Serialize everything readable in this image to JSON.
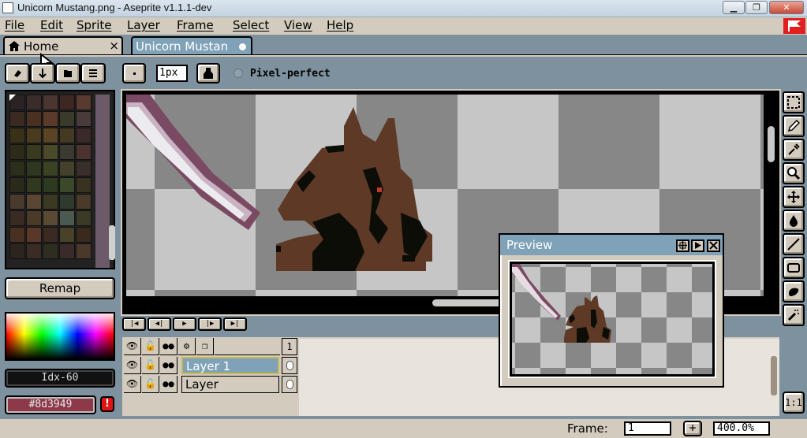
{
  "window": {
    "title": "Unicorn Mustang.png - Aseprite v1.1.1-dev",
    "minimize": "▁",
    "maximize": "❐",
    "close": "✕"
  },
  "menu": [
    "File",
    "Edit",
    "Sprite",
    "Layer",
    "Frame",
    "Select",
    "View",
    "Help"
  ],
  "tabs": {
    "home_label": "Home",
    "home_close": "×",
    "document_label": "Unicorn Mustan"
  },
  "context_bar": {
    "brush_size": "1px",
    "pixel_perfect_label": "Pixel-perfect",
    "pixel_perfect_checked": false
  },
  "palette": {
    "colors": [
      "#2a2224",
      "#3a2c2a",
      "#4a3530",
      "#3c2820",
      "#5a3a30",
      "#3a2a22",
      "#4a3020",
      "#5a3a28",
      "#3a3a2a",
      "#4a3a3a",
      "#3a3018",
      "#4a3a20",
      "#5a4424",
      "#443a22",
      "#3a2a2a",
      "#2e2a1a",
      "#3a3a20",
      "#4a4a2a",
      "#3a3a30",
      "#4a3430",
      "#2a2e1a",
      "#2e3820",
      "#3a4224",
      "#44402a",
      "#3a2e2a",
      "#2a2a1a",
      "#30381e",
      "#2c3a20",
      "#3a4a28",
      "#3a3220",
      "#4a3a2e",
      "#5a4632",
      "#3a3a22",
      "#2e3a2c",
      "#4a3a2a",
      "#3a2a24",
      "#4a3a28",
      "#5a4a34",
      "#4a5a50",
      "#3a3a26",
      "#4a3020",
      "#5a3828",
      "#3a2a22",
      "#4a4228",
      "#3a2a1e",
      "#2e241e",
      "#3a2c22",
      "#2e2e20",
      "#3a2a2a",
      "#4a382a"
    ],
    "remap_label": "Remap"
  },
  "colors": {
    "foreground_label": "Idx-60",
    "background_label": "#8d3949",
    "background_hex": "#8d3949",
    "warning_label": "!"
  },
  "timeline": {
    "play_buttons": [
      "|◀",
      "◀|",
      "▶",
      "|▶",
      "▶|"
    ],
    "header_frame": "1",
    "layers": [
      {
        "name": "Layer 1",
        "selected": true
      },
      {
        "name": "Layer",
        "selected": false
      }
    ],
    "one_to_one": "1:1"
  },
  "preview": {
    "title": "Preview"
  },
  "statusbar": {
    "frame_label": "Frame:",
    "frame_value": "1",
    "add_label": "+",
    "zoom_value": "400.0%"
  }
}
